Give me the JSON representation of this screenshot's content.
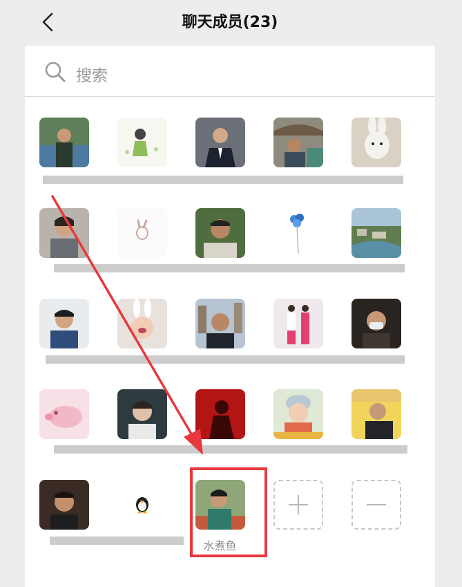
{
  "header": {
    "title": "聊天成员(23)"
  },
  "search": {
    "placeholder": "搜索"
  },
  "members": [
    {
      "name": "",
      "avatar": "man-lakeside"
    },
    {
      "name": "",
      "avatar": "girl-illustration"
    },
    {
      "name": "",
      "avatar": "man-suit"
    },
    {
      "name": "",
      "avatar": "man-umbrella"
    },
    {
      "name": "",
      "avatar": "white-rabbit"
    },
    {
      "name": "",
      "avatar": "woman-portrait"
    },
    {
      "name": "",
      "avatar": "victory-hand"
    },
    {
      "name": "",
      "avatar": "man-greenery"
    },
    {
      "name": "",
      "avatar": "blue-flower"
    },
    {
      "name": "",
      "avatar": "aerial-town"
    },
    {
      "name": "",
      "avatar": "boy-selfie"
    },
    {
      "name": "",
      "avatar": "child-bunny"
    },
    {
      "name": "",
      "avatar": "man-city"
    },
    {
      "name": "",
      "avatar": "two-dancers"
    },
    {
      "name": "",
      "avatar": "man-mask"
    },
    {
      "name": "",
      "avatar": "pink-pig"
    },
    {
      "name": "",
      "avatar": "young-man"
    },
    {
      "name": "",
      "avatar": "red-silhouette"
    },
    {
      "name": "",
      "avatar": "baby"
    },
    {
      "name": "",
      "avatar": "older-man"
    },
    {
      "name": "",
      "avatar": "man-dark"
    },
    {
      "name": "",
      "avatar": "penguin"
    },
    {
      "name": "水煮鱼",
      "avatar": "man-park"
    }
  ],
  "actions": {
    "add": "add-member",
    "remove": "remove-member"
  },
  "colors": {
    "highlight": "#e8383d",
    "arrow": "#e8383d"
  }
}
